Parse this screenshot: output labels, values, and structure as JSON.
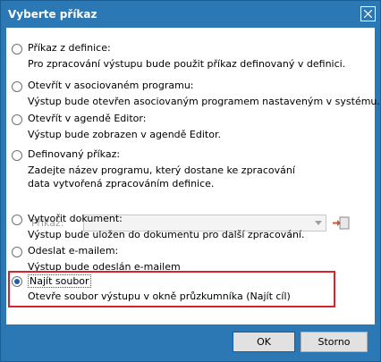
{
  "window": {
    "title": "Vyberte příkaz"
  },
  "options": [
    {
      "label": "Příkaz z definice:",
      "desc": [
        "Pro zpracování výstupu bude použit příkaz definovaný v definici."
      ]
    },
    {
      "label": "Otevřít v asociovaném programu:",
      "desc": [
        "Výstup bude otevřen asociovaným programem nastaveným v systému."
      ]
    },
    {
      "label": "Otevřít v agendě Editor:",
      "desc": [
        "Výstup bude zobrazen v agendě Editor."
      ]
    },
    {
      "label": "Definovaný příkaz:",
      "desc": [
        "Zadejte název programu, který dostane ke zpracování",
        "data vytvořená zpracováním definice."
      ]
    },
    {
      "label": "Vytvořit dokument:",
      "desc": [
        "Výstup bude uložen do dokumentu pro další zpracování."
      ]
    },
    {
      "label": "Odeslat e-mailem:",
      "desc": [
        "Výstup bude odeslán e-mailem"
      ]
    },
    {
      "label": "Najít soubor",
      "desc": [
        "Otevře soubor výstupu v okně průzkumníka (Najít cíl)"
      ]
    }
  ],
  "selected_option": 6,
  "command": {
    "label": "Příkaz:",
    "value": ""
  },
  "buttons": {
    "ok": "OK",
    "cancel": "Storno"
  },
  "colors": {
    "accent": "#2b78b5",
    "highlight": "#d9232c"
  }
}
